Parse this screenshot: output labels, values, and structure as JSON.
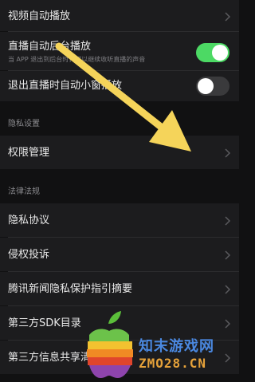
{
  "settings": {
    "video_autoplay": {
      "label": "视频自动播放"
    },
    "live_background": {
      "label": "直播自动后台播放",
      "subtitle": "当 APP 退出到后台时，可以继续收听直播的声音",
      "toggle_on": true
    },
    "live_pip": {
      "label": "退出直播时自动小窗播放",
      "toggle_on": false
    }
  },
  "privacy_section": {
    "header": "隐私设置",
    "permissions": {
      "label": "权限管理"
    }
  },
  "legal_section": {
    "header": "法律法规",
    "items": [
      {
        "label": "隐私协议"
      },
      {
        "label": "侵权投诉"
      },
      {
        "label": "腾讯新闻隐私保护指引摘要"
      },
      {
        "label": "第三方SDK目录"
      },
      {
        "label": "第三方信息共享清单"
      }
    ]
  },
  "watermark": {
    "cn": "知末游戏网",
    "en": "ZMO28.CN"
  },
  "colors": {
    "background": "#111112",
    "row": "#1c1c1e",
    "toggle_on": "#4cd964",
    "toggle_off": "#3a3a3c",
    "arrow": "#f5d45a"
  }
}
